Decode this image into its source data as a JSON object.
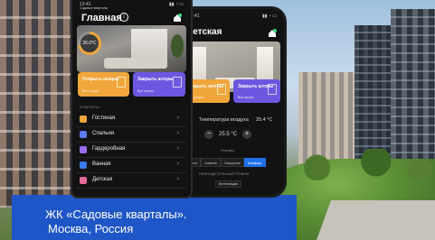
{
  "caption": {
    "line1": "ЖК «Садовые кварталы».",
    "line2": "Москва, Россия"
  },
  "phone1": {
    "status_time": "12:41",
    "status_carrier": "Садовые кварталы",
    "title": "Главная",
    "temperature": "26.0°C",
    "card_open": {
      "title": "Открыть шторы",
      "subtitle": "Все шторы"
    },
    "card_close": {
      "title": "Закрыть шторы",
      "subtitle": "Все шторы"
    },
    "rooms_header": "КОМНАТЫ",
    "rooms": [
      {
        "label": "Гостиная",
        "color": "#f0a63a"
      },
      {
        "label": "Спальня",
        "color": "#5b7cf0"
      },
      {
        "label": "Гардеробная",
        "color": "#9b6cf0"
      },
      {
        "label": "Ванная",
        "color": "#3a7bf0"
      },
      {
        "label": "Детская",
        "color": "#e36a9a"
      }
    ]
  },
  "phone2": {
    "status_time": "12:41",
    "title": "Детская",
    "card_open": {
      "title": "Открыть шторы",
      "subtitle": "Все шторы"
    },
    "card_close": {
      "title": "Закрыть шторы",
      "subtitle": "Все шторы"
    },
    "air_label": "Температура воздуха",
    "air_value": "25.4 °C",
    "setpoint": "25.5 °C",
    "modes_label": "Режимы",
    "modes": [
      "Авто",
      "Зимний",
      "Ожидание",
      "Комфорт"
    ],
    "active_mode": "Комфорт",
    "forced_label": "ПРИНУДИТЕЛЬНЫЙ РЕЖИМ",
    "ventilation_button": "Вентиляция"
  },
  "colors": {
    "accent_blue": "#1f6feb",
    "card_open_orange": "#f0a63a",
    "card_close_purple": "#6e57e0",
    "caption_bg": "#1f56c7"
  }
}
